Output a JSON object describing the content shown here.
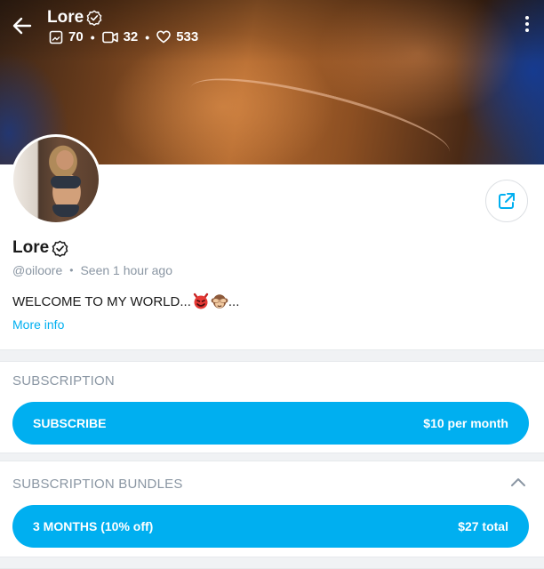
{
  "header": {
    "name": "Lore",
    "stats": {
      "photos": "70",
      "videos": "32",
      "likes": "533"
    }
  },
  "profile": {
    "name": "Lore",
    "handle": "@oiloore",
    "seen": "Seen",
    "seen_time": "1 hour ago",
    "bio": "WELCOME TO MY WORLD...",
    "bio_suffix": "...",
    "more_info": "More info"
  },
  "subscription": {
    "title": "SUBSCRIPTION",
    "button_label": "SUBSCRIBE",
    "button_price": "$10 per month"
  },
  "bundles": {
    "title": "SUBSCRIPTION BUNDLES",
    "items": [
      {
        "label": "3 MONTHS (10% off)",
        "price": "$27 total"
      }
    ]
  },
  "icons": {
    "back": "arrow-left-icon",
    "verified": "verified-badge-icon",
    "photos": "image-icon",
    "videos": "video-icon",
    "likes": "heart-icon",
    "menu": "more-vertical-icon",
    "share": "share-icon",
    "collapse": "chevron-up-icon"
  },
  "colors": {
    "accent": "#00aff0",
    "muted_text": "#8a96a3",
    "divider": "#f0f2f4"
  }
}
